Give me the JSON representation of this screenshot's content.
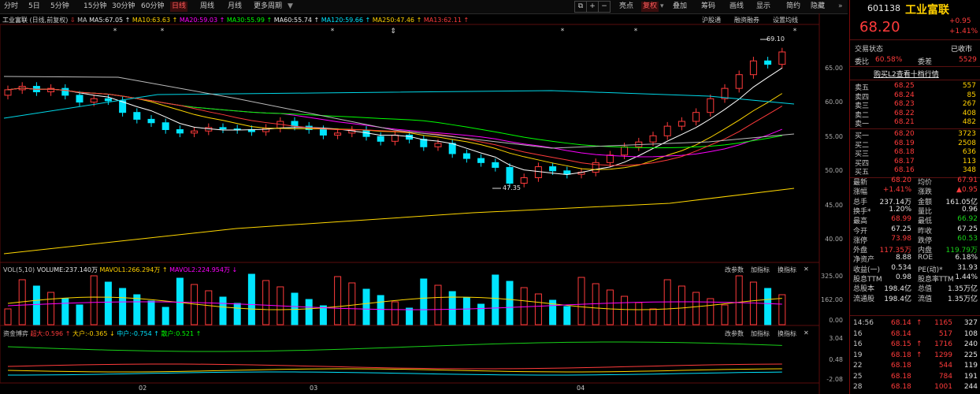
{
  "toolbar": {
    "tabs": [
      "分时",
      "5日",
      "5分钟",
      "15分钟",
      "30分钟",
      "60分钟",
      "日线",
      "周线",
      "月线",
      "更多周期"
    ],
    "active_tab": "日线",
    "right_buttons": [
      "亮点",
      "复权",
      "叠加",
      "画线",
      "显示",
      "简约",
      "隐藏"
    ]
  },
  "chart_header": {
    "name": "工业富联",
    "mode": "(日线,前复权)",
    "ma_label": "MA",
    "ma5": "MA5:67.05",
    "ma10": "MA10:63.63",
    "ma20": "MA20:59.03",
    "ma30": "MA30:55.99",
    "ma60": "MA60:55.74",
    "ma120": "MA120:59.66",
    "ma250": "MA250:47.46",
    "ma13": "MA13:62.11",
    "right_links": [
      "沪股通",
      "融资融券",
      "设置均线"
    ]
  },
  "price_axis": [
    "65.00",
    "60.00",
    "55.00",
    "50.00",
    "45.00",
    "40.00"
  ],
  "annotations": {
    "high": "69.10",
    "low": "47.35"
  },
  "volume_panel": {
    "title": "VOL(5,10)",
    "volume": "VOLUME:237.140万",
    "mavol1": "MAVOL1:266.294万",
    "mavol2": "MAVOL2:224.954万",
    "buttons": [
      "改参数",
      "加指标",
      "换指标"
    ],
    "axis": [
      "325.00",
      "162.00",
      "0.00"
    ]
  },
  "fund_panel": {
    "title": "资金博弈",
    "super": "超大:0.596",
    "big": "大户:-0.365",
    "mid": "中户:-0.754",
    "small": "散户:0.521",
    "buttons": [
      "改参数",
      "加指标",
      "换指标"
    ],
    "axis": [
      "3.04",
      "0.48",
      "-2.08"
    ]
  },
  "x_axis": [
    "02",
    "03",
    "04"
  ],
  "quote": {
    "code": "601138",
    "name": "工业富联",
    "price": "68.20",
    "change": "+0.95",
    "change_pct": "+1.41%",
    "trade_status_label": "交易状态",
    "trade_status": "已收市",
    "weibi_label": "委比",
    "weibi": "60.58%",
    "weicha_label": "委差",
    "weicha": "5529",
    "l2_link": "购买L2查看十档行情",
    "sell": [
      {
        "label": "卖五",
        "price": "68.25",
        "vol": "557"
      },
      {
        "label": "卖四",
        "price": "68.24",
        "vol": "85"
      },
      {
        "label": "卖三",
        "price": "68.23",
        "vol": "267"
      },
      {
        "label": "卖二",
        "price": "68.22",
        "vol": "408"
      },
      {
        "label": "卖一",
        "price": "68.21",
        "vol": "482"
      }
    ],
    "buy": [
      {
        "label": "买一",
        "price": "68.20",
        "vol": "3723"
      },
      {
        "label": "买二",
        "price": "68.19",
        "vol": "2508"
      },
      {
        "label": "买三",
        "price": "68.18",
        "vol": "636"
      },
      {
        "label": "买四",
        "price": "68.17",
        "vol": "113"
      },
      {
        "label": "买五",
        "price": "68.16",
        "vol": "348"
      }
    ],
    "stats": [
      [
        "最新",
        "68.20",
        "均价",
        "67.91"
      ],
      [
        "涨幅",
        "+1.41%",
        "涨跌",
        "▲0.95"
      ],
      [
        "总手",
        "237.14万",
        "金额",
        "161.05亿"
      ],
      [
        "换手*",
        "1.20%",
        "量比",
        "0.96"
      ],
      [
        "最高",
        "68.99",
        "最低",
        "66.92"
      ],
      [
        "今开",
        "67.25",
        "昨收",
        "67.25"
      ],
      [
        "涨停",
        "73.98",
        "跌停",
        "60.53"
      ],
      [
        "外盘",
        "117.35万",
        "内盘",
        "119.79万"
      ],
      [
        "净资产",
        "8.88",
        "ROE",
        "6.18%"
      ],
      [
        "收益(一)",
        "0.534",
        "PE(动)*",
        "31.93"
      ],
      [
        "股息TTM",
        "0.98",
        "股息率TTM",
        "1.44%"
      ],
      [
        "总股本",
        "198.4亿",
        "总值",
        "1.35万亿"
      ],
      [
        "流通股",
        "198.4亿",
        "流值",
        "1.35万亿"
      ]
    ],
    "ticks": [
      [
        "14:56",
        "68.14",
        "↑",
        "1165",
        "327"
      ],
      [
        "16",
        "68.14",
        "",
        "517",
        "108"
      ],
      [
        "16",
        "68.15",
        "↑",
        "1716",
        "240"
      ],
      [
        "19",
        "68.18",
        "↑",
        "1299",
        "225"
      ],
      [
        "22",
        "68.18",
        "",
        "544",
        "119"
      ],
      [
        "25",
        "68.18",
        "",
        "784",
        "191"
      ],
      [
        "28",
        "68.18",
        "",
        "1001",
        "244"
      ]
    ]
  },
  "colors": {
    "up": "#ff3b3b",
    "down": "#00e5ff",
    "accent": "#ff4040",
    "ma5": "#ffffff",
    "ma10": "#ffd700",
    "ma20": "#ff00ff",
    "ma30": "#00ff00"
  }
}
